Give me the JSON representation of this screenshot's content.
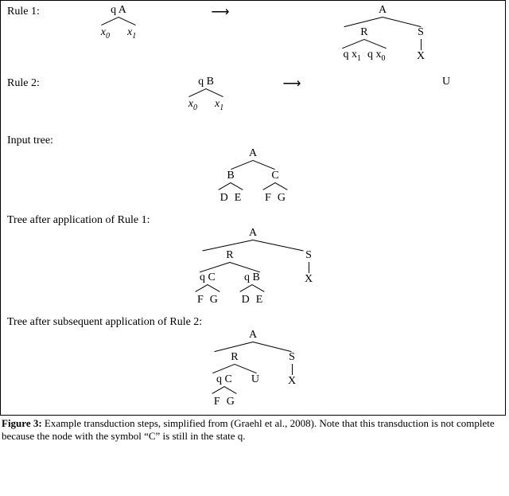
{
  "labels": {
    "rule1": "Rule 1:",
    "rule2": "Rule 2:",
    "input_tree": "Input tree:",
    "after_rule1": "Tree after application of Rule 1:",
    "after_rule2": "Tree after subsequent application of Rule 2:"
  },
  "arrow": "⟶",
  "nodes": {
    "qA": "q A",
    "qB": "q B",
    "qC": "q C",
    "A": "A",
    "B": "B",
    "C": "C",
    "D": "D",
    "E": "E",
    "F": "F",
    "G": "G",
    "R": "R",
    "S": "S",
    "U": "U",
    "X": "X",
    "x0": "x",
    "x0_sub": "0",
    "x1": "x",
    "x1_sub": "1",
    "qx0": "q x",
    "qx1": "q x"
  },
  "caption": {
    "lead": "Figure 3:",
    "text": " Example transduction steps, simplified from (Graehl et al., 2008). Note that this transduction is not complete because the node with the symbol “C” is still in the state q."
  }
}
